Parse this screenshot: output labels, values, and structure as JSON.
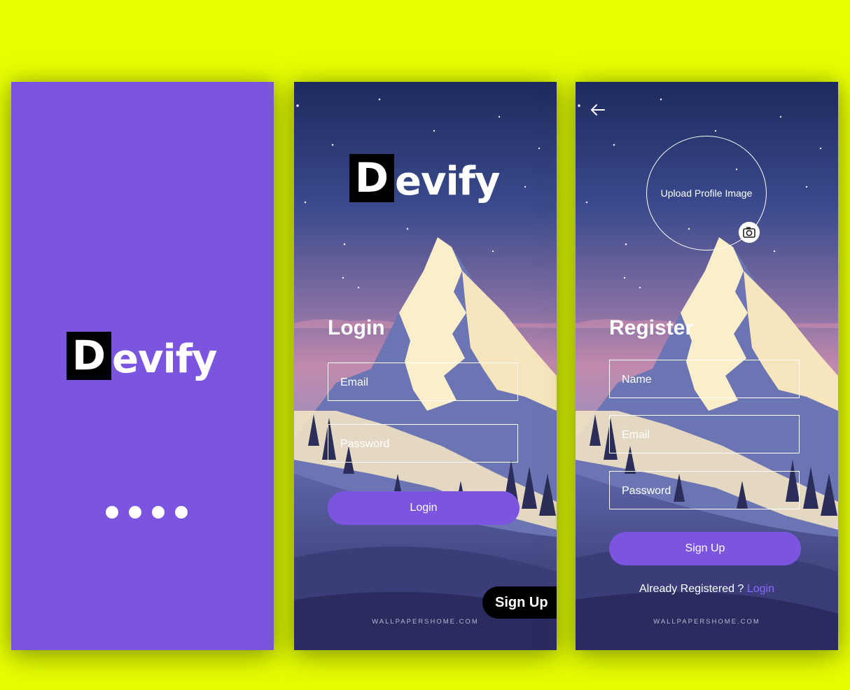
{
  "brand": {
    "logo_initial": "D",
    "logo_rest": "evify"
  },
  "splash": {
    "loading_dots": 4
  },
  "login": {
    "title": "Login",
    "email_placeholder": "Email",
    "password_placeholder": "Password",
    "login_button": "Login",
    "signup_button": "Sign Up",
    "credit": "WALLPAPERSHOME.COM"
  },
  "register": {
    "upload_label": "Upload Profile Image",
    "title": "Register",
    "name_placeholder": "Name",
    "email_placeholder": "Email",
    "password_placeholder": "Password",
    "signup_button": "Sign Up",
    "already_text": "Already Registered ?",
    "login_link": "Login",
    "credit": "WALLPAPERSHOME.COM"
  },
  "icons": {
    "back": "arrow-left-icon",
    "camera": "camera-icon"
  },
  "colors": {
    "background": "#e8ff00",
    "accent": "#7b55e0",
    "link": "#8b68ff",
    "button_dark": "#000000"
  }
}
